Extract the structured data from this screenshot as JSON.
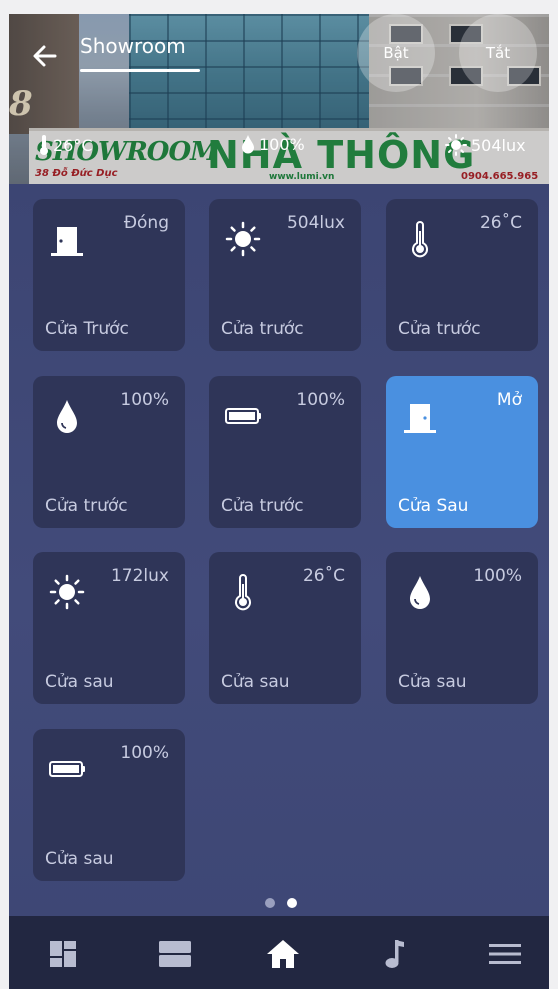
{
  "header": {
    "title": "Showroom",
    "on_label": "Bật",
    "off_label": "Tắt",
    "background": {
      "building_number": "8",
      "sign_left": "SHOWROOM",
      "sign_main": "NHÀ THÔNG MINH",
      "sign_address": "38 Đỗ Đức Dục",
      "sign_web": "www.lumi.vn",
      "sign_phone": "0904.665.965"
    }
  },
  "status": {
    "temperature": "26°C",
    "humidity": "100%",
    "light": "504lux"
  },
  "tiles": [
    {
      "icon": "door-closed-icon",
      "value": "Đóng",
      "label": "Cửa Trước",
      "active": false
    },
    {
      "icon": "sun-icon",
      "value": "504lux",
      "label": "Cửa trước",
      "active": false
    },
    {
      "icon": "thermometer-icon",
      "value": "26˚C",
      "label": "Cửa trước",
      "active": false
    },
    {
      "icon": "water-drop-icon",
      "value": "100%",
      "label": "Cửa trước",
      "active": false
    },
    {
      "icon": "battery-icon",
      "value": "100%",
      "label": "Cửa trước",
      "active": false
    },
    {
      "icon": "door-open-icon",
      "value": "Mở",
      "label": "Cửa Sau",
      "active": true
    },
    {
      "icon": "sun-icon",
      "value": "172lux",
      "label": "Cửa sau",
      "active": false
    },
    {
      "icon": "thermometer-icon",
      "value": "26˚C",
      "label": "Cửa sau",
      "active": false
    },
    {
      "icon": "water-drop-icon",
      "value": "100%",
      "label": "Cửa sau",
      "active": false
    },
    {
      "icon": "battery-icon",
      "value": "100%",
      "label": "Cửa sau",
      "active": false
    }
  ],
  "pager": {
    "pages": 2,
    "current": 2
  },
  "nav": {
    "items": [
      "dashboard-icon",
      "rooms-icon",
      "home-icon",
      "music-icon",
      "menu-icon"
    ],
    "active": "home-icon"
  },
  "colors": {
    "background": "#3e4775",
    "tile": "#2f3558",
    "tile_active": "#4a90e0",
    "nav_bar": "#222741",
    "nav_active": "#ffffff",
    "nav_inactive": "#b8bcd0"
  }
}
